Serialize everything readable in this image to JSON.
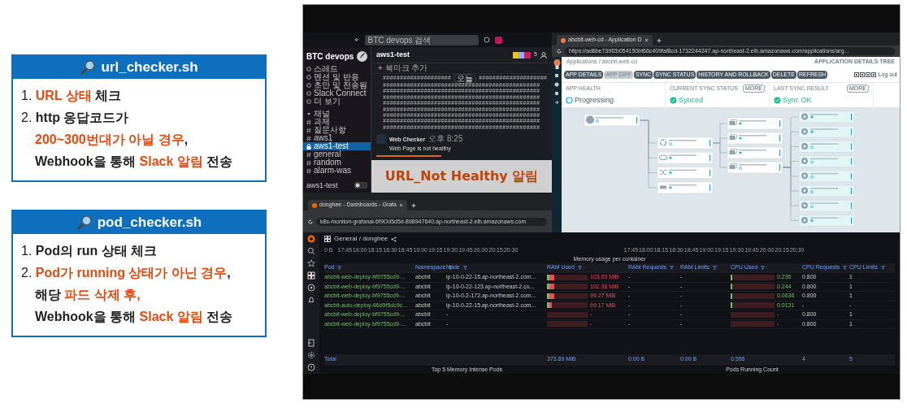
{
  "cards": [
    {
      "title": "url_checker.sh",
      "lines": [
        {
          "indent": false,
          "segments": [
            {
              "kind": "plain",
              "text": "1. "
            },
            {
              "kind": "accent",
              "text": "URL 상태"
            },
            {
              "kind": "bold",
              "text": " 체크"
            }
          ]
        },
        {
          "indent": false,
          "segments": [
            {
              "kind": "plain",
              "text": "2. "
            },
            {
              "kind": "bold",
              "text": "http 응답코드가"
            }
          ]
        },
        {
          "indent": true,
          "segments": [
            {
              "kind": "accent",
              "text": "200~300번대가 아닐 경우"
            },
            {
              "kind": "bold",
              "text": ","
            }
          ]
        },
        {
          "indent": true,
          "segments": [
            {
              "kind": "bold",
              "text": "Webhook을 통해 "
            },
            {
              "kind": "accent",
              "text": "Slack 알림"
            },
            {
              "kind": "bold",
              "text": " 전송"
            }
          ]
        }
      ]
    },
    {
      "title": "pod_checker.sh",
      "lines": [
        {
          "indent": false,
          "segments": [
            {
              "kind": "plain",
              "text": "1. "
            },
            {
              "kind": "bold",
              "text": "Pod의 run 상태 체크"
            }
          ]
        },
        {
          "indent": false,
          "segments": [
            {
              "kind": "plain",
              "text": "2. "
            },
            {
              "kind": "accent",
              "text": "Pod가 running 상태가 아닌 경우"
            },
            {
              "kind": "bold",
              "text": ","
            }
          ]
        },
        {
          "indent": true,
          "segments": [
            {
              "kind": "bold",
              "text": "해당 "
            },
            {
              "kind": "accent",
              "text": "파드 삭제 후,"
            }
          ]
        },
        {
          "indent": true,
          "segments": [
            {
              "kind": "bold",
              "text": "Webhook을 통해 "
            },
            {
              "kind": "accent",
              "text": "Slack 알림"
            },
            {
              "kind": "bold",
              "text": " 전송"
            }
          ]
        }
      ]
    }
  ],
  "screenshot": {
    "slack": {
      "search": "BTC devops 검색",
      "workspace": "BTC devops",
      "nav": [
        "스레드",
        "멘션 및 반응",
        "초안 및 전송됨",
        "Slack Connect",
        "더 보기"
      ],
      "section": "채널",
      "channels": [
        {
          "name": "과제",
          "selected": false
        },
        {
          "name": "질문사항",
          "selected": false
        },
        {
          "name": "aws1",
          "selected": false
        },
        {
          "name": "aws1-test",
          "selected": true
        },
        {
          "name": "general",
          "selected": false
        },
        {
          "name": "random",
          "selected": false
        },
        {
          "name": "alarm-was",
          "selected": false
        }
      ],
      "footer": "aws1-test",
      "channel": "aws1-test",
      "members": "5",
      "bookmark": "+ 북마크 추가",
      "date_divider": {
        "left": "####################",
        "label": "오늘",
        "right": "####################"
      },
      "hash_rows": [
        "##############################################",
        "##############################################",
        "##############################################",
        "##############################################",
        "##############################################",
        "##############################################",
        "##############################################",
        "##############################################"
      ],
      "message": {
        "sender": "Web Checker",
        "time": "오후 8:25",
        "text": "Web Page is not healthy"
      },
      "callout": "URL_Not Healthy 알림"
    },
    "argo": {
      "tab": "abcbit-web-cd - Application D",
      "url": "https://ad8be739f2b054150bf66c409faf8cd-1732244247.ap-northeast-2.elb.amazonaws.com/applications/arg...",
      "breadcrumb": "Applications / abcbit-web-cd",
      "view_title": "APPLICATION DETAILS TREE",
      "buttons": [
        {
          "label": "APP DETAILS",
          "disabled": false
        },
        {
          "label": "APP DIFF",
          "disabled": true
        },
        {
          "label": "SYNC",
          "disabled": false
        },
        {
          "label": "SYNC STATUS",
          "disabled": false
        },
        {
          "label": "HISTORY AND ROLLBACK",
          "disabled": false
        },
        {
          "label": "DELETE",
          "disabled": false
        },
        {
          "label": "REFRESH",
          "disabled": false
        }
      ],
      "logout": "Log out",
      "status": [
        {
          "label": "APP HEALTH",
          "value": "Progressing",
          "kind": "progressing"
        },
        {
          "label": "CURRENT SYNC STATUS",
          "value": "Synced",
          "kind": "ok",
          "more": "MORE"
        },
        {
          "label": "LAST SYNC RESULT",
          "value": "Sync OK",
          "kind": "ok",
          "more": "MORE"
        }
      ],
      "tree": {
        "kind": "app",
        "healthy": false,
        "children": [
          {
            "kind": "deploy",
            "healthy": false,
            "children": [
              {
                "kind": "rs",
                "healthy": true
              },
              {
                "kind": "rs",
                "healthy": true
              },
              {
                "kind": "rs",
                "healthy": true
              },
              {
                "kind": "rs",
                "healthy": false,
                "children": [
                  {
                    "kind": "pod",
                    "healthy": true
                  },
                  {
                    "kind": "pod",
                    "healthy": true
                  },
                  {
                    "kind": "pod",
                    "healthy": false
                  },
                  {
                    "kind": "pod",
                    "healthy": false
                  },
                  {
                    "kind": "pod",
                    "healthy": false
                  },
                  {
                    "kind": "pod",
                    "healthy": false
                  },
                  {
                    "kind": "pod",
                    "healthy": false
                  },
                  {
                    "kind": "pod",
                    "healthy": true
                  }
                ]
              }
            ]
          },
          {
            "kind": "hpa",
            "healthy": true
          },
          {
            "kind": "ingress",
            "healthy": true
          },
          {
            "kind": "svc",
            "healthy": true
          }
        ]
      }
    },
    "grafana": {
      "tab": "donghee - Dashboards - Grafa",
      "url": "k8s-monitori-grafanai-6f9Od5d5d-898947640.ap-northeast-2.elb.amazonaws.com",
      "breadcrumb": "General / donghee",
      "axes": [
        {
          "unit": "0 B",
          "ticks": [
            "17:45",
            "18:00",
            "18:15",
            "18:30",
            "18:45",
            "19:00",
            "19:15",
            "19:30",
            "19:45",
            "20:00",
            "20:15",
            "20:30"
          ]
        },
        {
          "ticks": [
            "17:45",
            "18:00",
            "18:15",
            "18:30",
            "18:45",
            "19:00",
            "19:15",
            "19:30",
            "19:45",
            "20:00",
            "20:15",
            "20:30"
          ]
        }
      ],
      "panel_title": "Memory usage per container",
      "columns": [
        "Pod",
        "Namespace",
        "Node",
        "RAM Used",
        "RAM Requests",
        "RAM Limits",
        "CPU Used",
        "CPU Requests",
        "CPU Limits"
      ],
      "rows": [
        {
          "pod": "abcbit-web-deploy-bf9755cd9-...",
          "namespace": "abcbit",
          "node": "ip-10-0-22-15.ap-northeast-2.com...",
          "ram_used": {
            "level": 0.18,
            "reading": "103.09 MiB"
          },
          "ram_requests": "-",
          "ram_limits": "-",
          "cpu_used": {
            "level": 0.04,
            "reading": "0.235"
          },
          "cpu_requests": "0.800",
          "cpu_limits": "1"
        },
        {
          "pod": "abcbit-web-deploy-bf9755cd9-...",
          "namespace": "abcbit",
          "node": "ip-10-0-22-123.ap-northeast-2.co...",
          "ram_used": {
            "level": 0.17,
            "reading": "102.36 MiB"
          },
          "ram_requests": "-",
          "ram_limits": "-",
          "cpu_used": {
            "level": 0.04,
            "reading": "0.244"
          },
          "cpu_requests": "0.800",
          "cpu_limits": "1"
        },
        {
          "pod": "abcbit-web-deploy-bf9755cd9-...",
          "namespace": "abcbit",
          "node": "ip-10-0-2-172.ap-northeast-2.com...",
          "ram_used": {
            "level": 0.17,
            "reading": "99.27 MiB"
          },
          "ram_requests": "-",
          "ram_limits": "-",
          "cpu_used": {
            "level": 0.04,
            "reading": "0.0636"
          },
          "cpu_requests": "0.800",
          "cpu_limits": "1"
        },
        {
          "pod": "abcbit-auto-deploy-66d9f5dc9c...",
          "namespace": "abcbit",
          "node": "ip-10-0-22-15.ap-northeast-2.com...",
          "ram_used": {
            "level": 0.12,
            "reading": "69.17 MiB"
          },
          "ram_requests": "-",
          "ram_limits": "-",
          "cpu_used": {
            "level": 0.04,
            "reading": "0.0131"
          },
          "cpu_requests": "-",
          "cpu_limits": "-"
        },
        {
          "pod": "abcbit-web-deploy-bf9755cd9-...",
          "namespace": "abcbit",
          "node": "-",
          "ram_used": {
            "level": 0,
            "reading": "-"
          },
          "ram_requests": "-",
          "ram_limits": "-",
          "cpu_used": {
            "level": 0,
            "reading": "-"
          },
          "cpu_requests": "0.800",
          "cpu_limits": "1"
        },
        {
          "pod": "abcbit-web-deploy-bf9755cd9-...",
          "namespace": "abcbit",
          "node": "-",
          "ram_used": {
            "level": 0,
            "reading": "-"
          },
          "ram_requests": "-",
          "ram_limits": "-",
          "cpu_used": {
            "level": 0,
            "reading": "-"
          },
          "cpu_requests": "0.800",
          "cpu_limits": "1"
        }
      ],
      "totals": [
        "Total",
        "373.89 MiB",
        "0.00 B",
        "0.00 B",
        "0.556",
        "4",
        "5"
      ],
      "bottom_panels": [
        "Top 5 Memory Intense Pods",
        "Pods Running Count"
      ]
    }
  }
}
